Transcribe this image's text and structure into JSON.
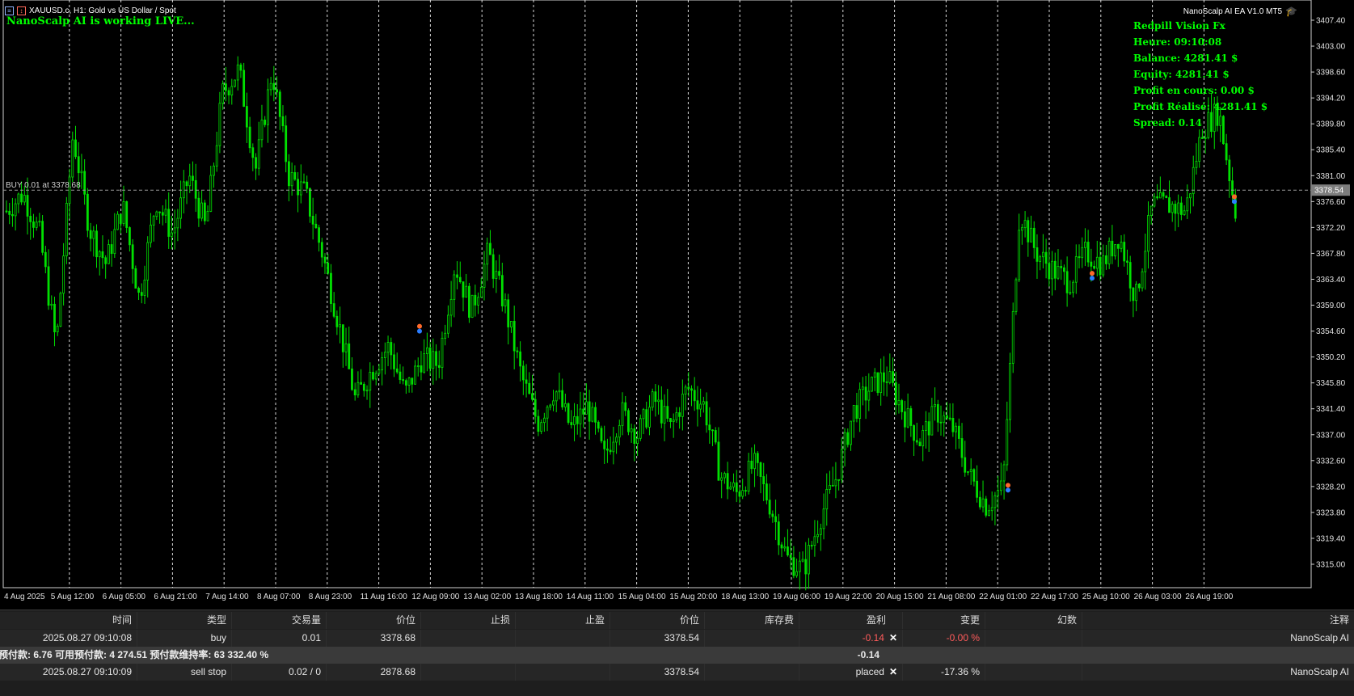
{
  "header": {
    "symbol_title": "XAUUSD.c, H1:  Gold vs US Dollar / Spot",
    "live_status": "NanoScalp AI is working LIVE...",
    "ea_label": "NanoScalp AI EA V1.0 MT5"
  },
  "info_panel": {
    "lines": [
      "Redpill Vision Fx",
      "Heure: 09:10:08",
      "Balance: 4281.41 $",
      "Equity: 4281.41 $",
      "Profit en cours: 0.00 $",
      "Profit Réalisé: 4281.41 $",
      "Spread: 0.14"
    ]
  },
  "chart_data": {
    "type": "candlestick",
    "symbol": "XAUUSD.c",
    "timeframe": "H1",
    "ylim": [
      3311.0,
      3409.0
    ],
    "price_ticks": [
      "3407.40",
      "3403.00",
      "3398.60",
      "3394.20",
      "3389.80",
      "3385.40",
      "3381.00",
      "3376.60",
      "3372.20",
      "3367.80",
      "3363.40",
      "3359.00",
      "3354.60",
      "3350.20",
      "3345.80",
      "3341.40",
      "3337.00",
      "3332.60",
      "3328.20",
      "3323.80",
      "3319.40",
      "3315.00"
    ],
    "time_ticks": [
      "4 Aug 2025",
      "5 Aug 12:00",
      "6 Aug 05:00",
      "6 Aug 21:00",
      "7 Aug 14:00",
      "8 Aug 07:00",
      "8 Aug 23:00",
      "11 Aug 16:00",
      "12 Aug 09:00",
      "13 Aug 02:00",
      "13 Aug 18:00",
      "14 Aug 11:00",
      "15 Aug 04:00",
      "15 Aug 20:00",
      "18 Aug 13:00",
      "19 Aug 06:00",
      "19 Aug 22:00",
      "20 Aug 15:00",
      "21 Aug 08:00",
      "22 Aug 01:00",
      "22 Aug 17:00",
      "25 Aug 10:00",
      "26 Aug 03:00",
      "26 Aug 19:00"
    ],
    "current_price": "3378.54",
    "buy_line_label": "BUY 0.01 at 3378.68",
    "price_path": [
      3375,
      3378,
      3371,
      3352,
      3388,
      3372,
      3366,
      3376,
      3360,
      3377,
      3371,
      3381,
      3372,
      3395,
      3399,
      3382,
      3399,
      3381,
      3378,
      3368,
      3356,
      3343,
      3348,
      3352,
      3344,
      3350,
      3349,
      3366,
      3358,
      3368,
      3359,
      3347,
      3339,
      3345,
      3338,
      3342,
      3333,
      3341,
      3337,
      3343,
      3338,
      3345,
      3342,
      3330,
      3327,
      3332,
      3325,
      3316,
      3314,
      3323,
      3330,
      3341,
      3345,
      3347,
      3341,
      3336,
      3341,
      3338,
      3330,
      3325,
      3328,
      3375,
      3368,
      3365,
      3363,
      3368,
      3366,
      3371,
      3360,
      3376,
      3376,
      3375,
      3389,
      3392,
      3375
    ]
  },
  "positions_table": {
    "headers": [
      "时间",
      "类型",
      "交易量",
      "价位",
      "止损",
      "止盈",
      "价位",
      "库存费",
      "盈利",
      "变更",
      "幻数",
      "注释"
    ],
    "rows": [
      {
        "time": "2025.08.27 09:10:08",
        "type": "buy",
        "volume": "0.01",
        "price": "3378.68",
        "sl": "",
        "tp": "",
        "current": "3378.54",
        "swap": "",
        "profit": "-0.14",
        "change": "-0.00 %",
        "magic": "",
        "comment": "NanoScalp AI"
      },
      {
        "time": "2025.08.27 09:10:09",
        "type": "sell stop",
        "volume": "0.02 / 0",
        "price": "2878.68",
        "sl": "",
        "tp": "",
        "current": "3378.54",
        "swap": "",
        "profit": "placed",
        "change": "-17.36 %",
        "magic": "",
        "comment": "NanoScalp  AI"
      }
    ],
    "summary_text": "预付款: 6.76   可用预付款: 4 274.51   预付款维持率: 63 332.40 %",
    "summary_profit": "-0.14"
  },
  "colors": {
    "background": "#000000",
    "candle": "#00e000",
    "grid": "#ffffff",
    "accent_text": "#00ff00",
    "loss": "#ff5b5b"
  }
}
